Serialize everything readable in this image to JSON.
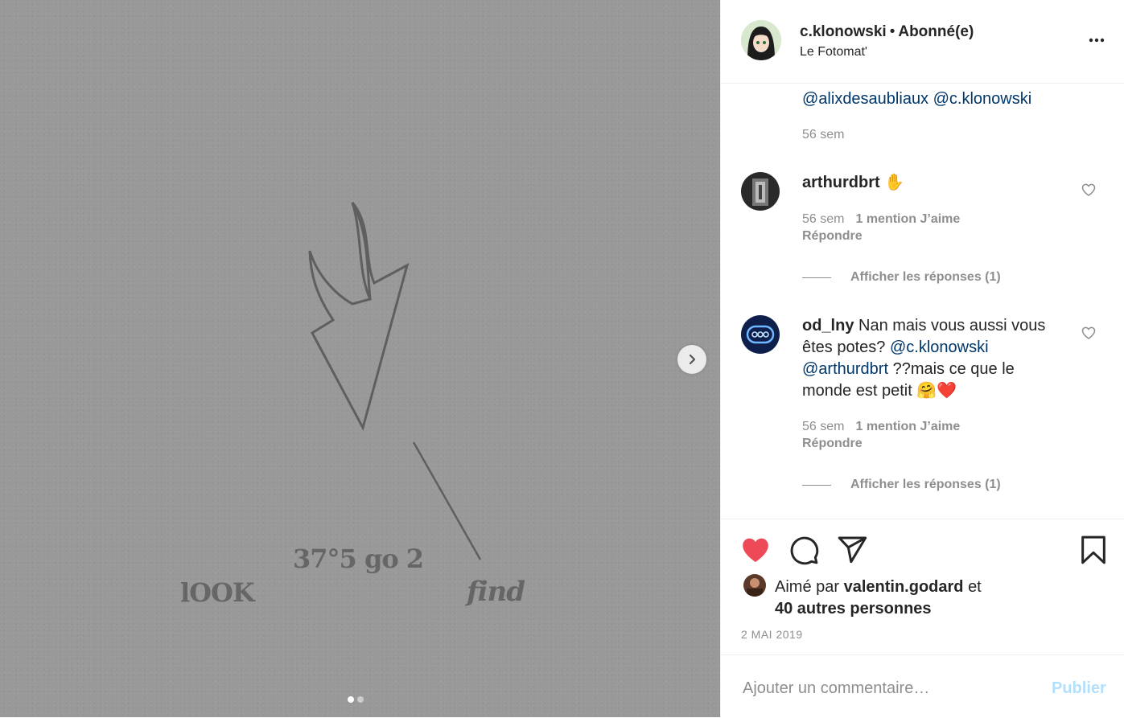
{
  "photo": {
    "overlay_text": [
      "37°5 go 2",
      "lOOK",
      "find"
    ],
    "carousel_total": 2,
    "carousel_active": 1
  },
  "header": {
    "username": "c.klonowski",
    "separator": "•",
    "follow_status": "Abonné(e)",
    "location": "Le Fotomat'"
  },
  "partial_comment": {
    "mention_1": "@alixdesaubliaux",
    "mention_2": "@c.klonowski",
    "time": "56 sem"
  },
  "comments": [
    {
      "username": "arthurdbrt",
      "text": "✋",
      "time": "56 sem",
      "likes": "1 mention J’aime",
      "reply": "Répondre",
      "view_replies": "Afficher les réponses (1)"
    },
    {
      "username": "od_lny",
      "text_start": "Nan mais vous aussi vous êtes potes?",
      "mention_1": "@c.klonowski",
      "mention_2": "@arthurdbrt",
      "text_end": "??mais ce que le monde est petit",
      "emoji": "🤗❤️",
      "time": "56 sem",
      "likes": "1 mention J’aime",
      "reply": "Répondre",
      "view_replies": "Afficher les réponses (1)"
    }
  ],
  "actions": {
    "liked_prefix": "Aimé par",
    "liked_user": "valentin.godard",
    "liked_and": "et",
    "liked_others": "40 autres personnes",
    "date": "2 MAI 2019"
  },
  "add_comment": {
    "placeholder": "Ajouter un commentaire…",
    "publish": "Publier"
  },
  "colors": {
    "like_red": "#ed4956",
    "mention_blue": "#00376b",
    "publish_disabled": "#b2dffc",
    "muted": "#8e8e8e"
  }
}
